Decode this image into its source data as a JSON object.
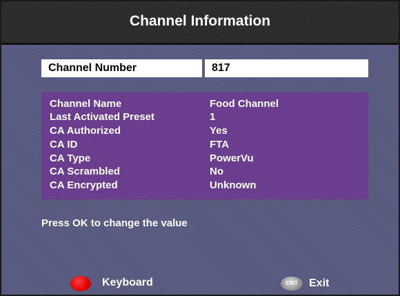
{
  "title": "Channel Information",
  "channel_number": {
    "label": "Channel Number",
    "value": "817"
  },
  "info": [
    {
      "label": "Channel Name",
      "value": "Food Channel"
    },
    {
      "label": "Last Activated Preset",
      "value": "1"
    },
    {
      "label": "CA Authorized",
      "value": "Yes"
    },
    {
      "label": "CA ID",
      "value": "FTA"
    },
    {
      "label": "CA Type",
      "value": "PowerVu"
    },
    {
      "label": "CA Scrambled",
      "value": "No"
    },
    {
      "label": "CA Encrypted",
      "value": "Unknown"
    }
  ],
  "hint": "Press OK to change the value",
  "footer": {
    "keyboard_label": "Keyboard",
    "exit_icon_text": "EXIT",
    "exit_label": "Exit"
  },
  "colors": {
    "background": "#585a80",
    "title_bar": "#2a2a2a",
    "panel": "#6a3b8e",
    "keyboard_button": "#e00000"
  }
}
